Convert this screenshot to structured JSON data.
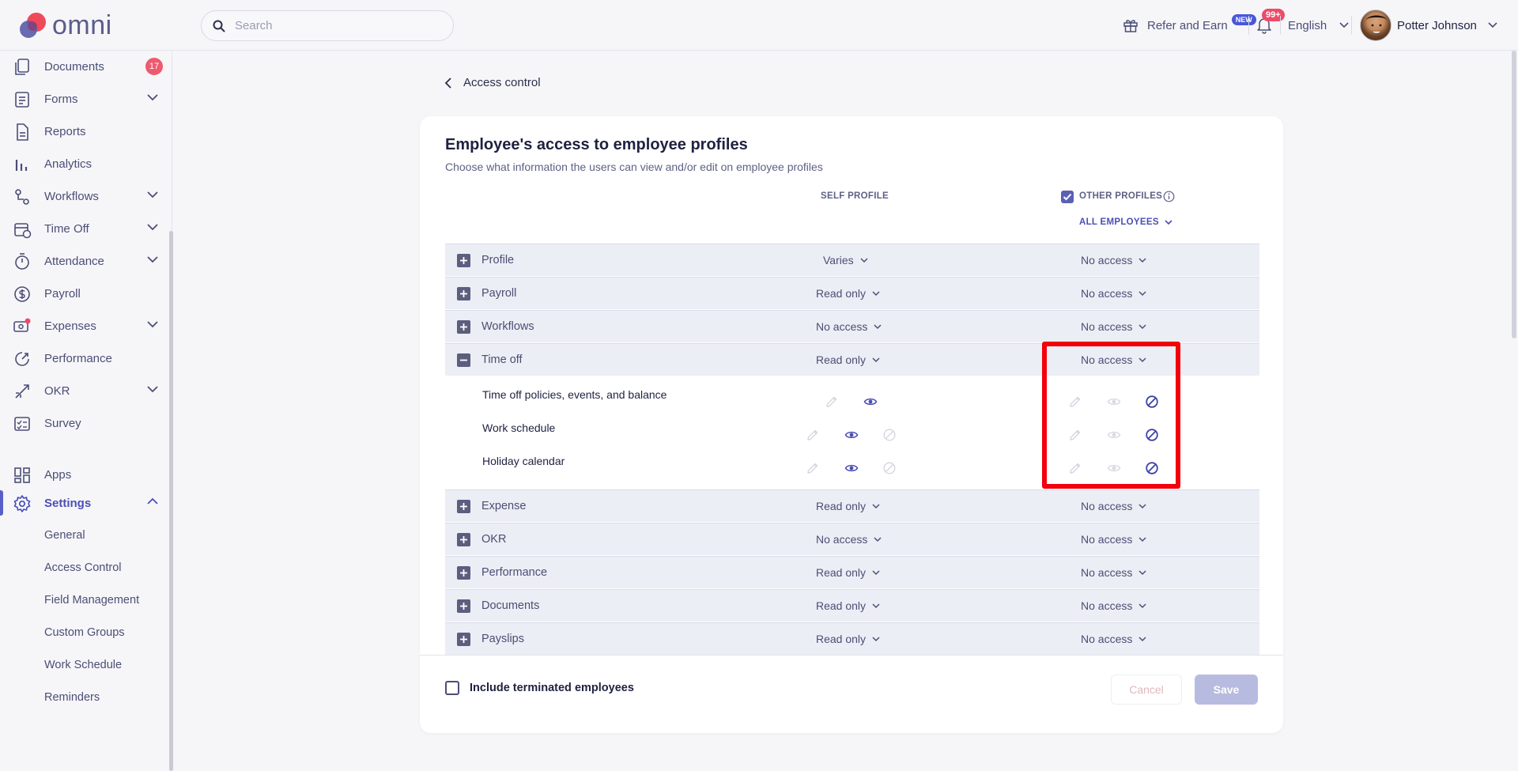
{
  "header": {
    "brand": "omni",
    "search_placeholder": "Search",
    "refer_label": "Refer and Earn",
    "new_badge": "NEW",
    "notifications_badge": "99+",
    "language": "English",
    "user_name": "Potter Johnson"
  },
  "sidebar": {
    "items": [
      {
        "label": "Documents",
        "count": "17"
      },
      {
        "label": "Forms"
      },
      {
        "label": "Reports"
      },
      {
        "label": "Analytics"
      },
      {
        "label": "Workflows"
      },
      {
        "label": "Time Off"
      },
      {
        "label": "Attendance"
      },
      {
        "label": "Payroll"
      },
      {
        "label": "Expenses"
      },
      {
        "label": "Performance"
      },
      {
        "label": "OKR"
      },
      {
        "label": "Survey"
      },
      {
        "label": "Apps"
      },
      {
        "label": "Settings"
      }
    ],
    "settings_sub": [
      "General",
      "Access Control",
      "Field Management",
      "Custom Groups",
      "Work Schedule",
      "Reminders"
    ]
  },
  "main": {
    "back_label": "Access control",
    "title": "Employee's access to employee profiles",
    "subtitle": "Choose what information the users can view and/or edit on employee profiles",
    "self_profile_header": "SELF PROFILE",
    "other_profiles_header": "OTHER PROFILES",
    "all_employees": "ALL EMPLOYEES",
    "rows": [
      {
        "name": "Profile",
        "self": "Varies",
        "other": "No access"
      },
      {
        "name": "Payroll",
        "self": "Read only",
        "other": "No access"
      },
      {
        "name": "Workflows",
        "self": "No access",
        "other": "No access"
      },
      {
        "name": "Time off",
        "self": "Read only",
        "other": "No access"
      },
      {
        "name": "Expense",
        "self": "Read only",
        "other": "No access"
      },
      {
        "name": "OKR",
        "self": "No access",
        "other": "No access"
      },
      {
        "name": "Performance",
        "self": "Read only",
        "other": "No access"
      },
      {
        "name": "Documents",
        "self": "Read only",
        "other": "No access"
      },
      {
        "name": "Payslips",
        "self": "Read only",
        "other": "No access"
      }
    ],
    "timeoff_sub": [
      {
        "name": "Time off policies, events, and balance"
      },
      {
        "name": "Work schedule"
      },
      {
        "name": "Holiday calendar"
      }
    ],
    "include_terminated": "Include terminated employees",
    "cancel_label": "Cancel",
    "save_label": "Save",
    "colors": {
      "accent": "#5a60b3",
      "highlight": "#f2000b"
    }
  }
}
